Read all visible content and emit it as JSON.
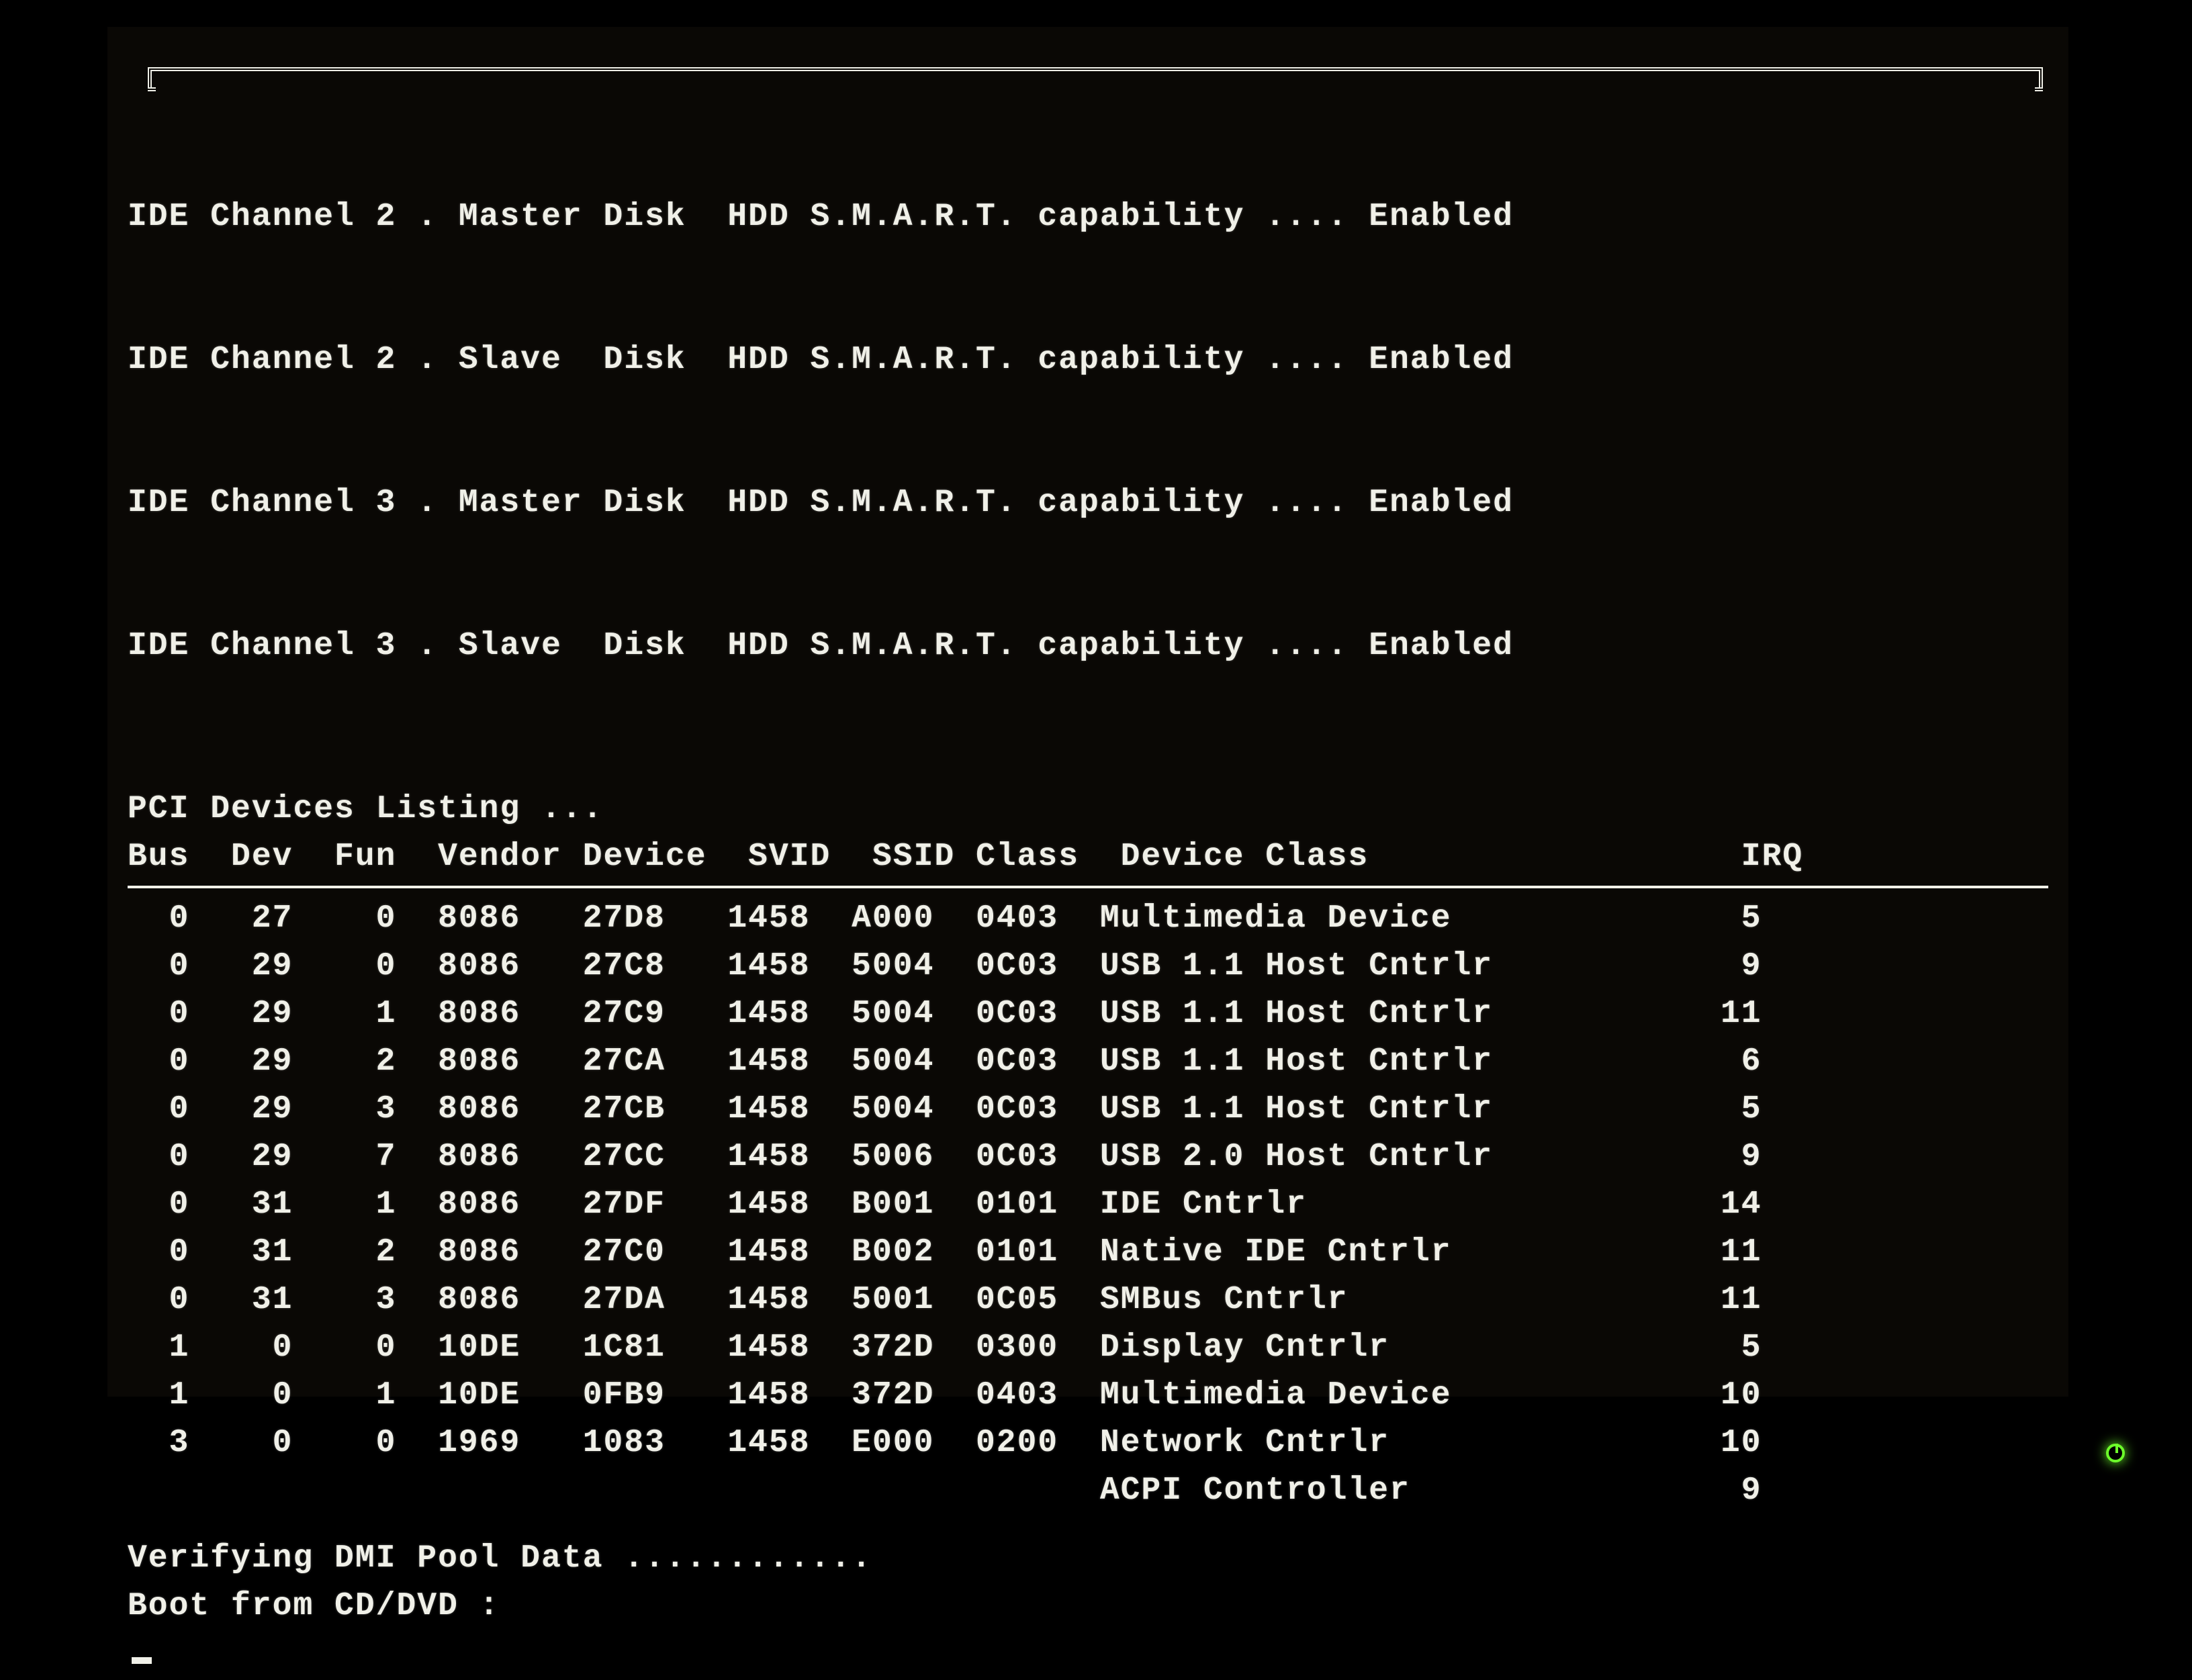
{
  "ide": [
    "IDE Channel 2 . Master Disk  HDD S.M.A.R.T. capability .... Enabled",
    "IDE Channel 2 . Slave  Disk  HDD S.M.A.R.T. capability .... Enabled",
    "IDE Channel 3 . Master Disk  HDD S.M.A.R.T. capability .... Enabled",
    "IDE Channel 3 . Slave  Disk  HDD S.M.A.R.T. capability .... Enabled"
  ],
  "pci_title": "PCI Devices Listing ...",
  "pci_header": "Bus  Dev  Fun  Vendor Device  SVID  SSID Class  Device Class                  IRQ",
  "pci_rows": [
    {
      "bus": "0",
      "dev": "27",
      "fun": "0",
      "vendor": "8086",
      "device": "27D8",
      "svid": "1458",
      "ssid": "A000",
      "cls": "0403",
      "dclass": "Multimedia Device",
      "irq": "5"
    },
    {
      "bus": "0",
      "dev": "29",
      "fun": "0",
      "vendor": "8086",
      "device": "27C8",
      "svid": "1458",
      "ssid": "5004",
      "cls": "0C03",
      "dclass": "USB 1.1 Host Cntrlr",
      "irq": "9"
    },
    {
      "bus": "0",
      "dev": "29",
      "fun": "1",
      "vendor": "8086",
      "device": "27C9",
      "svid": "1458",
      "ssid": "5004",
      "cls": "0C03",
      "dclass": "USB 1.1 Host Cntrlr",
      "irq": "11"
    },
    {
      "bus": "0",
      "dev": "29",
      "fun": "2",
      "vendor": "8086",
      "device": "27CA",
      "svid": "1458",
      "ssid": "5004",
      "cls": "0C03",
      "dclass": "USB 1.1 Host Cntrlr",
      "irq": "6"
    },
    {
      "bus": "0",
      "dev": "29",
      "fun": "3",
      "vendor": "8086",
      "device": "27CB",
      "svid": "1458",
      "ssid": "5004",
      "cls": "0C03",
      "dclass": "USB 1.1 Host Cntrlr",
      "irq": "5"
    },
    {
      "bus": "0",
      "dev": "29",
      "fun": "7",
      "vendor": "8086",
      "device": "27CC",
      "svid": "1458",
      "ssid": "5006",
      "cls": "0C03",
      "dclass": "USB 2.0 Host Cntrlr",
      "irq": "9"
    },
    {
      "bus": "0",
      "dev": "31",
      "fun": "1",
      "vendor": "8086",
      "device": "27DF",
      "svid": "1458",
      "ssid": "B001",
      "cls": "0101",
      "dclass": "IDE Cntrlr",
      "irq": "14"
    },
    {
      "bus": "0",
      "dev": "31",
      "fun": "2",
      "vendor": "8086",
      "device": "27C0",
      "svid": "1458",
      "ssid": "B002",
      "cls": "0101",
      "dclass": "Native IDE Cntrlr",
      "irq": "11"
    },
    {
      "bus": "0",
      "dev": "31",
      "fun": "3",
      "vendor": "8086",
      "device": "27DA",
      "svid": "1458",
      "ssid": "5001",
      "cls": "0C05",
      "dclass": "SMBus Cntrlr",
      "irq": "11"
    },
    {
      "bus": "1",
      "dev": "0",
      "fun": "0",
      "vendor": "10DE",
      "device": "1C81",
      "svid": "1458",
      "ssid": "372D",
      "cls": "0300",
      "dclass": "Display Cntrlr",
      "irq": "5"
    },
    {
      "bus": "1",
      "dev": "0",
      "fun": "1",
      "vendor": "10DE",
      "device": "0FB9",
      "svid": "1458",
      "ssid": "372D",
      "cls": "0403",
      "dclass": "Multimedia Device",
      "irq": "10"
    },
    {
      "bus": "3",
      "dev": "0",
      "fun": "0",
      "vendor": "1969",
      "device": "1083",
      "svid": "1458",
      "ssid": "E000",
      "cls": "0200",
      "dclass": "Network Cntrlr",
      "irq": "10"
    },
    {
      "bus": "",
      "dev": "",
      "fun": "",
      "vendor": "",
      "device": "",
      "svid": "",
      "ssid": "",
      "cls": "",
      "dclass": "ACPI Controller",
      "irq": "9"
    }
  ],
  "footer": {
    "verify": "Verifying DMI Pool Data ............",
    "boot": "Boot from CD/DVD :"
  }
}
